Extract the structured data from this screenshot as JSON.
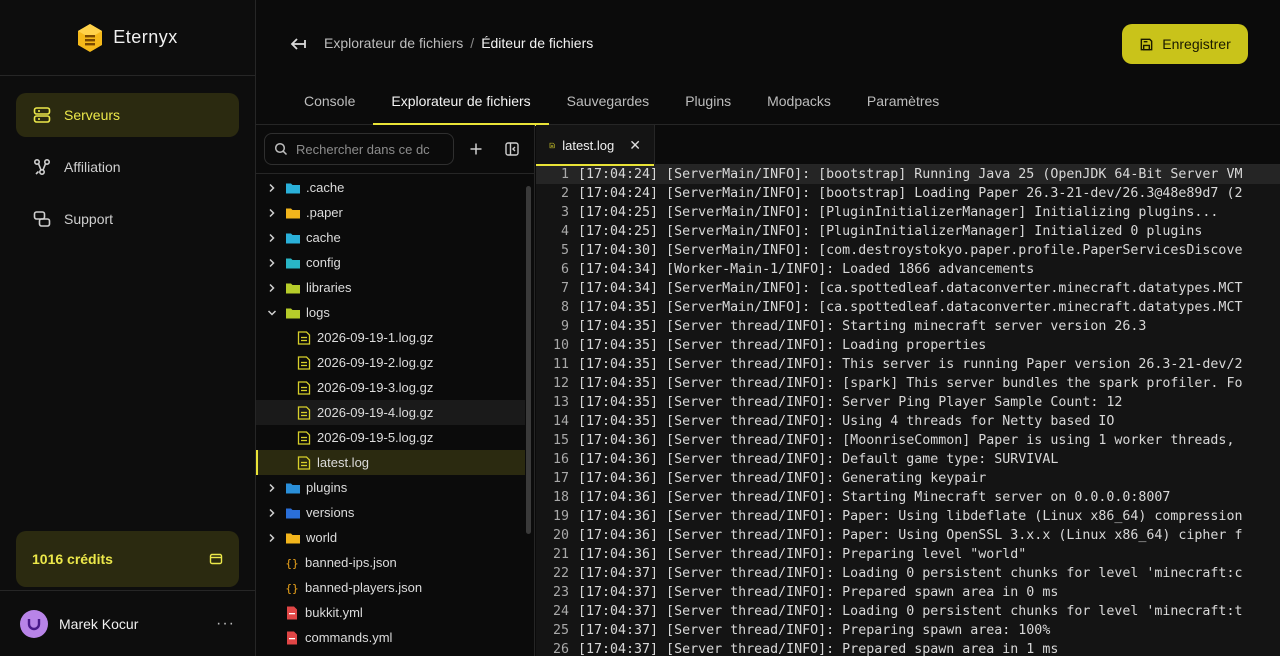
{
  "brand": {
    "name": "Eternyx"
  },
  "nav": [
    {
      "label": "Serveurs",
      "icon": "server-icon",
      "active": true
    },
    {
      "label": "Affiliation",
      "icon": "affiliate-icon",
      "active": false
    },
    {
      "label": "Support",
      "icon": "support-icon",
      "active": false
    }
  ],
  "credits": {
    "label": "1016 crédits"
  },
  "user": {
    "name": "Marek Kocur",
    "menu": "···"
  },
  "breadcrumb": {
    "parent": "Explorateur de fichiers",
    "separator": "/",
    "current": "Éditeur de fichiers"
  },
  "save_button": {
    "label": "Enregistrer"
  },
  "tabs": [
    "Console",
    "Explorateur de fichiers",
    "Sauvegardes",
    "Plugins",
    "Modpacks",
    "Paramètres"
  ],
  "active_tab": "Explorateur de fichiers",
  "search": {
    "placeholder": "Rechercher dans ce dc"
  },
  "tree": [
    {
      "name": ".cache",
      "type": "folder",
      "color": "#2ab0d9",
      "expanded": false
    },
    {
      "name": ".paper",
      "type": "folder",
      "color": "#f2b51c",
      "expanded": false
    },
    {
      "name": "cache",
      "type": "folder",
      "color": "#2ab0d9",
      "expanded": false
    },
    {
      "name": "config",
      "type": "folder",
      "color": "#29b6c6",
      "expanded": false
    },
    {
      "name": "libraries",
      "type": "folder",
      "color": "#b6cc2a",
      "expanded": false
    },
    {
      "name": "logs",
      "type": "folder",
      "color": "#b6cc2a",
      "expanded": true
    },
    {
      "name": "2026-09-19-1.log.gz",
      "type": "log",
      "child": true
    },
    {
      "name": "2026-09-19-2.log.gz",
      "type": "log",
      "child": true
    },
    {
      "name": "2026-09-19-3.log.gz",
      "type": "log",
      "child": true
    },
    {
      "name": "2026-09-19-4.log.gz",
      "type": "log",
      "child": true,
      "hover": true
    },
    {
      "name": "2026-09-19-5.log.gz",
      "type": "log",
      "child": true
    },
    {
      "name": "latest.log",
      "type": "log",
      "child": true,
      "selected": true
    },
    {
      "name": "plugins",
      "type": "folder",
      "color": "#2a8fd9",
      "expanded": false
    },
    {
      "name": "versions",
      "type": "folder",
      "color": "#2a6fd9",
      "expanded": false
    },
    {
      "name": "world",
      "type": "folder",
      "color": "#f2b51c",
      "expanded": false
    },
    {
      "name": "banned-ips.json",
      "type": "json"
    },
    {
      "name": "banned-players.json",
      "type": "json"
    },
    {
      "name": "bukkit.yml",
      "type": "yml"
    },
    {
      "name": "commands.yml",
      "type": "yml"
    }
  ],
  "editor": {
    "tab_label": "latest.log",
    "lines": [
      "[17:04:24] [ServerMain/INFO]: [bootstrap] Running Java 25 (OpenJDK 64-Bit Server VM",
      "[17:04:24] [ServerMain/INFO]: [bootstrap] Loading Paper 26.3-21-dev/26.3@48e89d7 (2",
      "[17:04:25] [ServerMain/INFO]: [PluginInitializerManager] Initializing plugins...",
      "[17:04:25] [ServerMain/INFO]: [PluginInitializerManager] Initialized 0 plugins",
      "[17:04:30] [ServerMain/INFO]: [com.destroystokyo.paper.profile.PaperServicesDiscove",
      "[17:04:34] [Worker-Main-1/INFO]: Loaded 1866 advancements",
      "[17:04:34] [ServerMain/INFO]: [ca.spottedleaf.dataconverter.minecraft.datatypes.MCT",
      "[17:04:35] [ServerMain/INFO]: [ca.spottedleaf.dataconverter.minecraft.datatypes.MCT",
      "[17:04:35] [Server thread/INFO]: Starting minecraft server version 26.3",
      "[17:04:35] [Server thread/INFO]: Loading properties",
      "[17:04:35] [Server thread/INFO]: This server is running Paper version 26.3-21-dev/2",
      "[17:04:35] [Server thread/INFO]: [spark] This server bundles the spark profiler. Fo",
      "[17:04:35] [Server thread/INFO]: Server Ping Player Sample Count: 12",
      "[17:04:35] [Server thread/INFO]: Using 4 threads for Netty based IO",
      "[17:04:36] [Server thread/INFO]: [MoonriseCommon] Paper is using 1 worker threads,",
      "[17:04:36] [Server thread/INFO]: Default game type: SURVIVAL",
      "[17:04:36] [Server thread/INFO]: Generating keypair",
      "[17:04:36] [Server thread/INFO]: Starting Minecraft server on 0.0.0.0:8007",
      "[17:04:36] [Server thread/INFO]: Paper: Using libdeflate (Linux x86_64) compression",
      "[17:04:36] [Server thread/INFO]: Paper: Using OpenSSL 3.x.x (Linux x86_64) cipher f",
      "[17:04:36] [Server thread/INFO]: Preparing level \"world\"",
      "[17:04:37] [Server thread/INFO]: Loading 0 persistent chunks for level 'minecraft:c",
      "[17:04:37] [Server thread/INFO]: Prepared spawn area in 0 ms",
      "[17:04:37] [Server thread/INFO]: Loading 0 persistent chunks for level 'minecraft:t",
      "[17:04:37] [Server thread/INFO]: Preparing spawn area: 100%",
      "[17:04:37] [Server thread/INFO]: Prepared spawn area in 1 ms"
    ]
  },
  "colors": {
    "accent": "#e9e337",
    "accent_bg": "#2b2a10",
    "save_bg": "#c9c31a"
  }
}
